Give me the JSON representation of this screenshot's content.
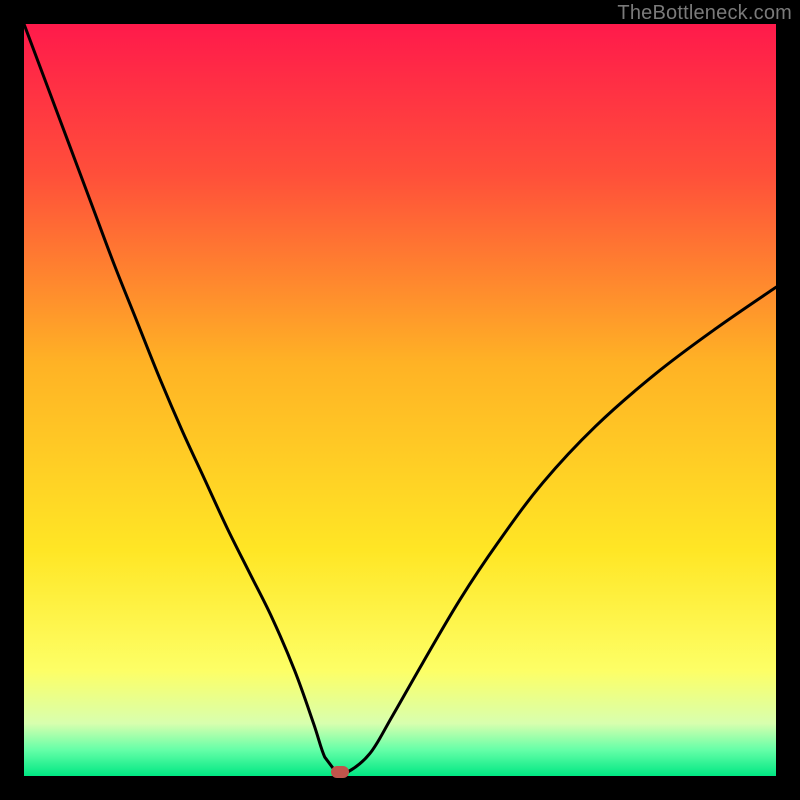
{
  "watermark": "TheBottleneck.com",
  "colors": {
    "black": "#000000",
    "curve": "#000000",
    "marker": "#c1544b",
    "gradient_stops": [
      {
        "pos": 0.0,
        "color": "#ff1a4b"
      },
      {
        "pos": 0.2,
        "color": "#ff4f3a"
      },
      {
        "pos": 0.45,
        "color": "#ffb225"
      },
      {
        "pos": 0.7,
        "color": "#ffe625"
      },
      {
        "pos": 0.86,
        "color": "#fdff66"
      },
      {
        "pos": 0.93,
        "color": "#d8ffae"
      },
      {
        "pos": 0.965,
        "color": "#66ffa8"
      },
      {
        "pos": 1.0,
        "color": "#00e783"
      }
    ]
  },
  "chart_data": {
    "type": "line",
    "title": "",
    "xlabel": "",
    "ylabel": "",
    "xlim": [
      0,
      100
    ],
    "ylim": [
      0,
      100
    ],
    "x": [
      0,
      3,
      6,
      9,
      12,
      15,
      18,
      21,
      24,
      27,
      30,
      33,
      36,
      38.5,
      40,
      41.5,
      43,
      46,
      49,
      53,
      58,
      63,
      69,
      76,
      84,
      92,
      100
    ],
    "series": [
      {
        "name": "bottleneck-curve",
        "values": [
          100,
          92,
          84,
          76,
          68,
          60.5,
          53,
          46,
          39.5,
          33,
          27,
          21,
          14,
          7,
          2.5,
          0.5,
          0.5,
          3,
          8,
          15,
          23.5,
          31,
          39,
          46.5,
          53.5,
          59.5,
          65
        ]
      }
    ],
    "marker": {
      "x": 42,
      "y": 0.5
    },
    "flat_valley": {
      "x_start": 39.5,
      "x_end": 43,
      "y": 0.5
    }
  },
  "layout": {
    "outer": 800,
    "inset": 24,
    "plot_size": 752
  }
}
